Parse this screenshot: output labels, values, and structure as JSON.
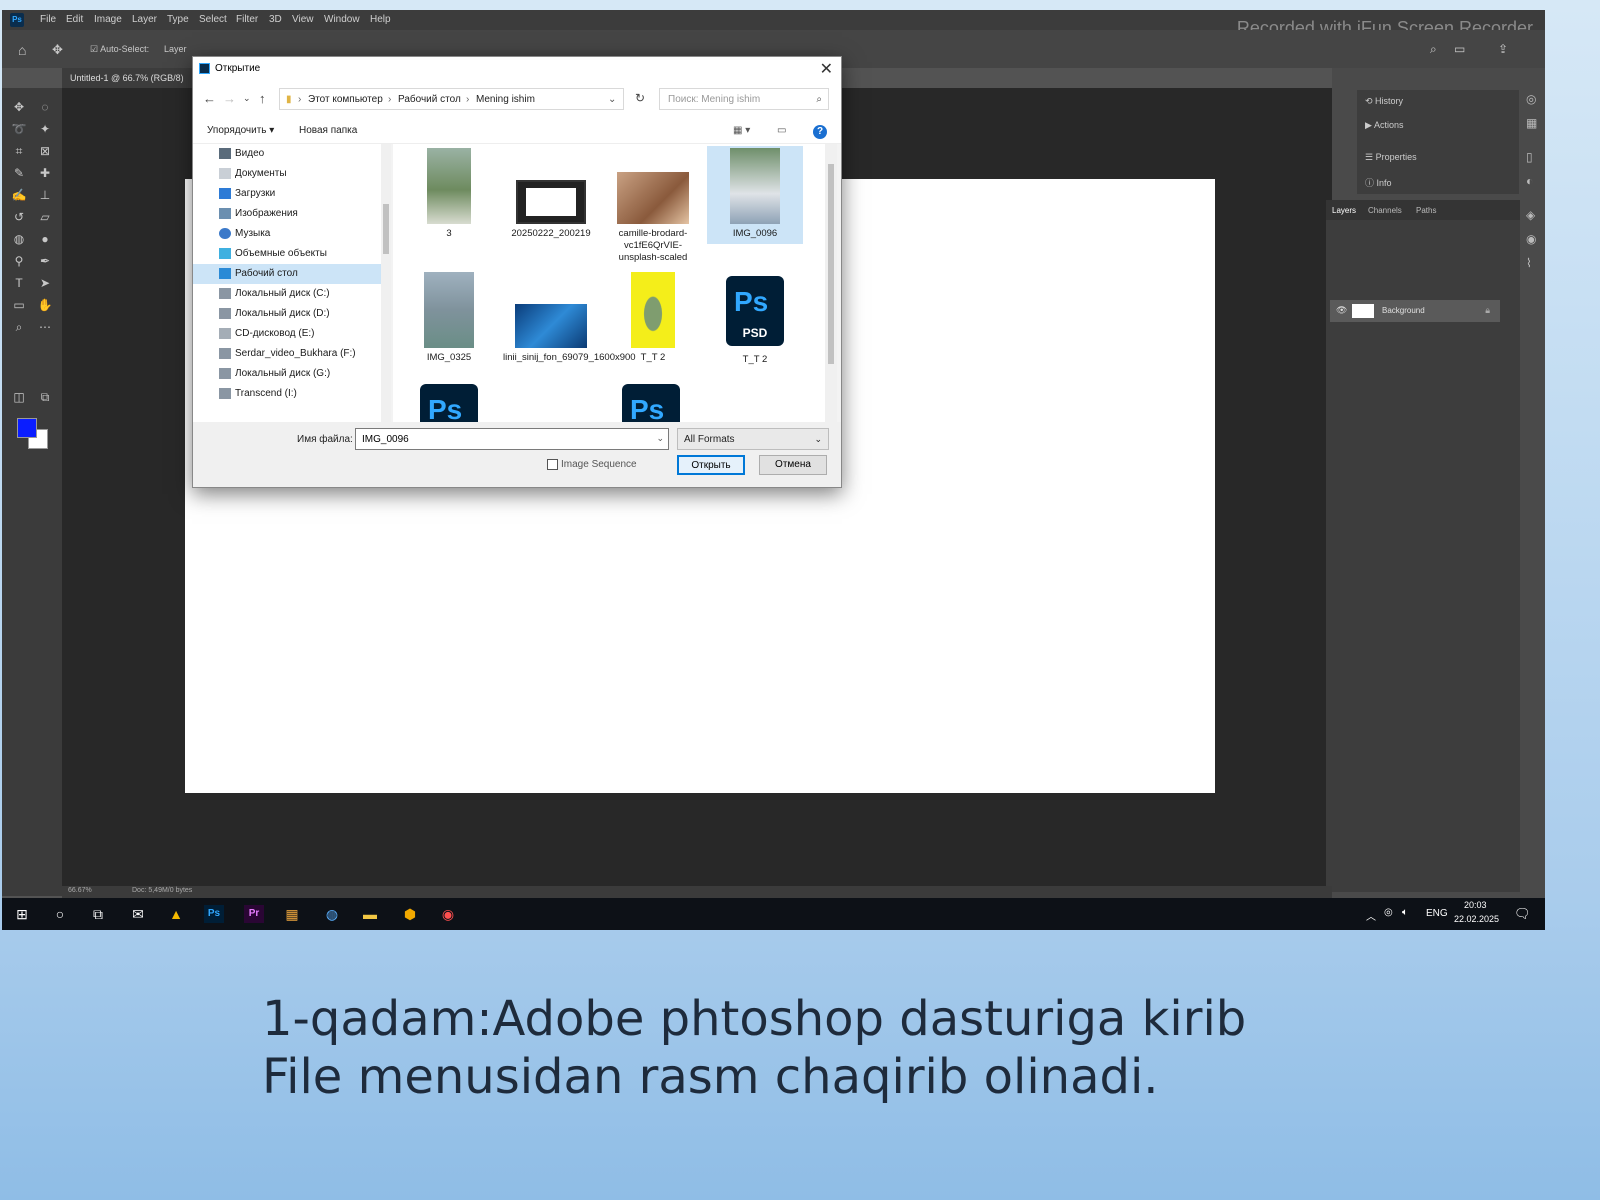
{
  "app": {
    "menu": [
      "File",
      "Edit",
      "Image",
      "Layer",
      "Type",
      "Select",
      "Filter",
      "3D",
      "View",
      "Window",
      "Help"
    ],
    "watermark": "Recorded with iFun Screen Recorder",
    "options": {
      "auto_select": "Auto-Select:",
      "layer": "Layer"
    },
    "doc_tab": "Untitled-1 @ 66.7% (RGB/8)",
    "mini_panel": [
      "History",
      "Actions",
      "Properties",
      "Info"
    ],
    "layers_tabs": [
      "Layers",
      "Channels",
      "Paths"
    ],
    "layer_name": "Background",
    "status": {
      "zoom": "66.67%",
      "doc": "Doc: 5,49M/0 bytes"
    },
    "colors": {
      "foreground": "#0a1dff",
      "background": "#ffffff"
    }
  },
  "dialog": {
    "title": "Открытие",
    "breadcrumb": [
      "Этот компьютер",
      "Рабочий стол",
      "Mening ishim"
    ],
    "search_placeholder": "Поиск: Mening ishim",
    "organize": "Упорядочить ▾",
    "new_folder": "Новая папка",
    "nav": [
      {
        "label": "Видео",
        "icon": "video-icon"
      },
      {
        "label": "Документы",
        "icon": "documents-icon"
      },
      {
        "label": "Загрузки",
        "icon": "downloads-icon"
      },
      {
        "label": "Изображения",
        "icon": "pictures-icon"
      },
      {
        "label": "Музыка",
        "icon": "music-icon"
      },
      {
        "label": "Объемные объекты",
        "icon": "3d-objects-icon"
      },
      {
        "label": "Рабочий стол",
        "icon": "desktop-icon",
        "selected": true
      },
      {
        "label": "Локальный диск (C:)",
        "icon": "drive-icon"
      },
      {
        "label": "Локальный диск (D:)",
        "icon": "drive-icon"
      },
      {
        "label": "CD-дисковод (E:)",
        "icon": "cd-drive-icon"
      },
      {
        "label": "Serdar_video_Bukhara (F:)",
        "icon": "drive-icon"
      },
      {
        "label": "Локальный диск (G:)",
        "icon": "drive-icon"
      },
      {
        "label": "Transcend (I:)",
        "icon": "drive-icon"
      }
    ],
    "files": [
      {
        "label": "3",
        "kind": "photo"
      },
      {
        "label": "20250222_200219",
        "kind": "screen"
      },
      {
        "label": "camille-brodard-vc1fE6QrVIE-unsplash-scaled",
        "kind": "photo-warm"
      },
      {
        "label": "IMG_0096",
        "kind": "photo",
        "selected": true
      },
      {
        "label": "IMG_0325",
        "kind": "photo"
      },
      {
        "label": "linii_sinij_fon_69079_1600x900",
        "kind": "blue"
      },
      {
        "label": "T_T 2",
        "kind": "yellow"
      },
      {
        "label": "T_T 2",
        "kind": "psd"
      }
    ],
    "filename_label": "Имя файла:",
    "filename_value": "IMG_0096",
    "format": "All Formats",
    "image_sequence": "Image Sequence",
    "open": "Открыть",
    "cancel": "Отмена"
  },
  "taskbar": {
    "lang": "ENG",
    "time": "20:03",
    "date": "22.02.2025"
  },
  "caption": {
    "line1": "1-qadam:Adobe phtoshop dasturiga kirib",
    "line2": "File menusidan rasm chaqirib olinadi."
  }
}
